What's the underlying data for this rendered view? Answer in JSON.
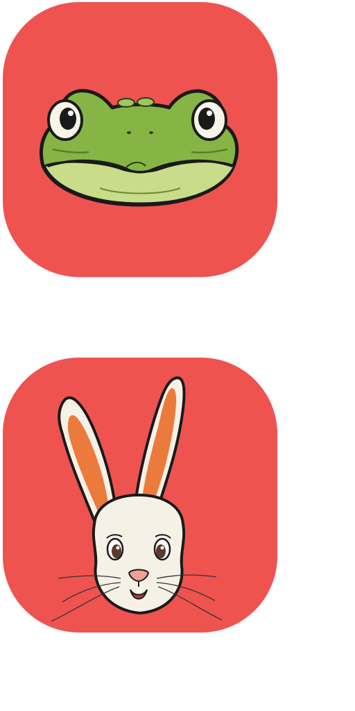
{
  "icons": [
    {
      "name": "frog",
      "background": "#EF5350"
    },
    {
      "name": "rabbit",
      "background": "#EF5350"
    }
  ],
  "colors": {
    "tile_red": "#EF5350",
    "frog_green": "#86B545",
    "frog_belly": "#C9DC8A",
    "rabbit_fur": "#F6F1E6",
    "rabbit_ear_inner": "#EC7A3C",
    "rabbit_nose": "#F2A091"
  }
}
